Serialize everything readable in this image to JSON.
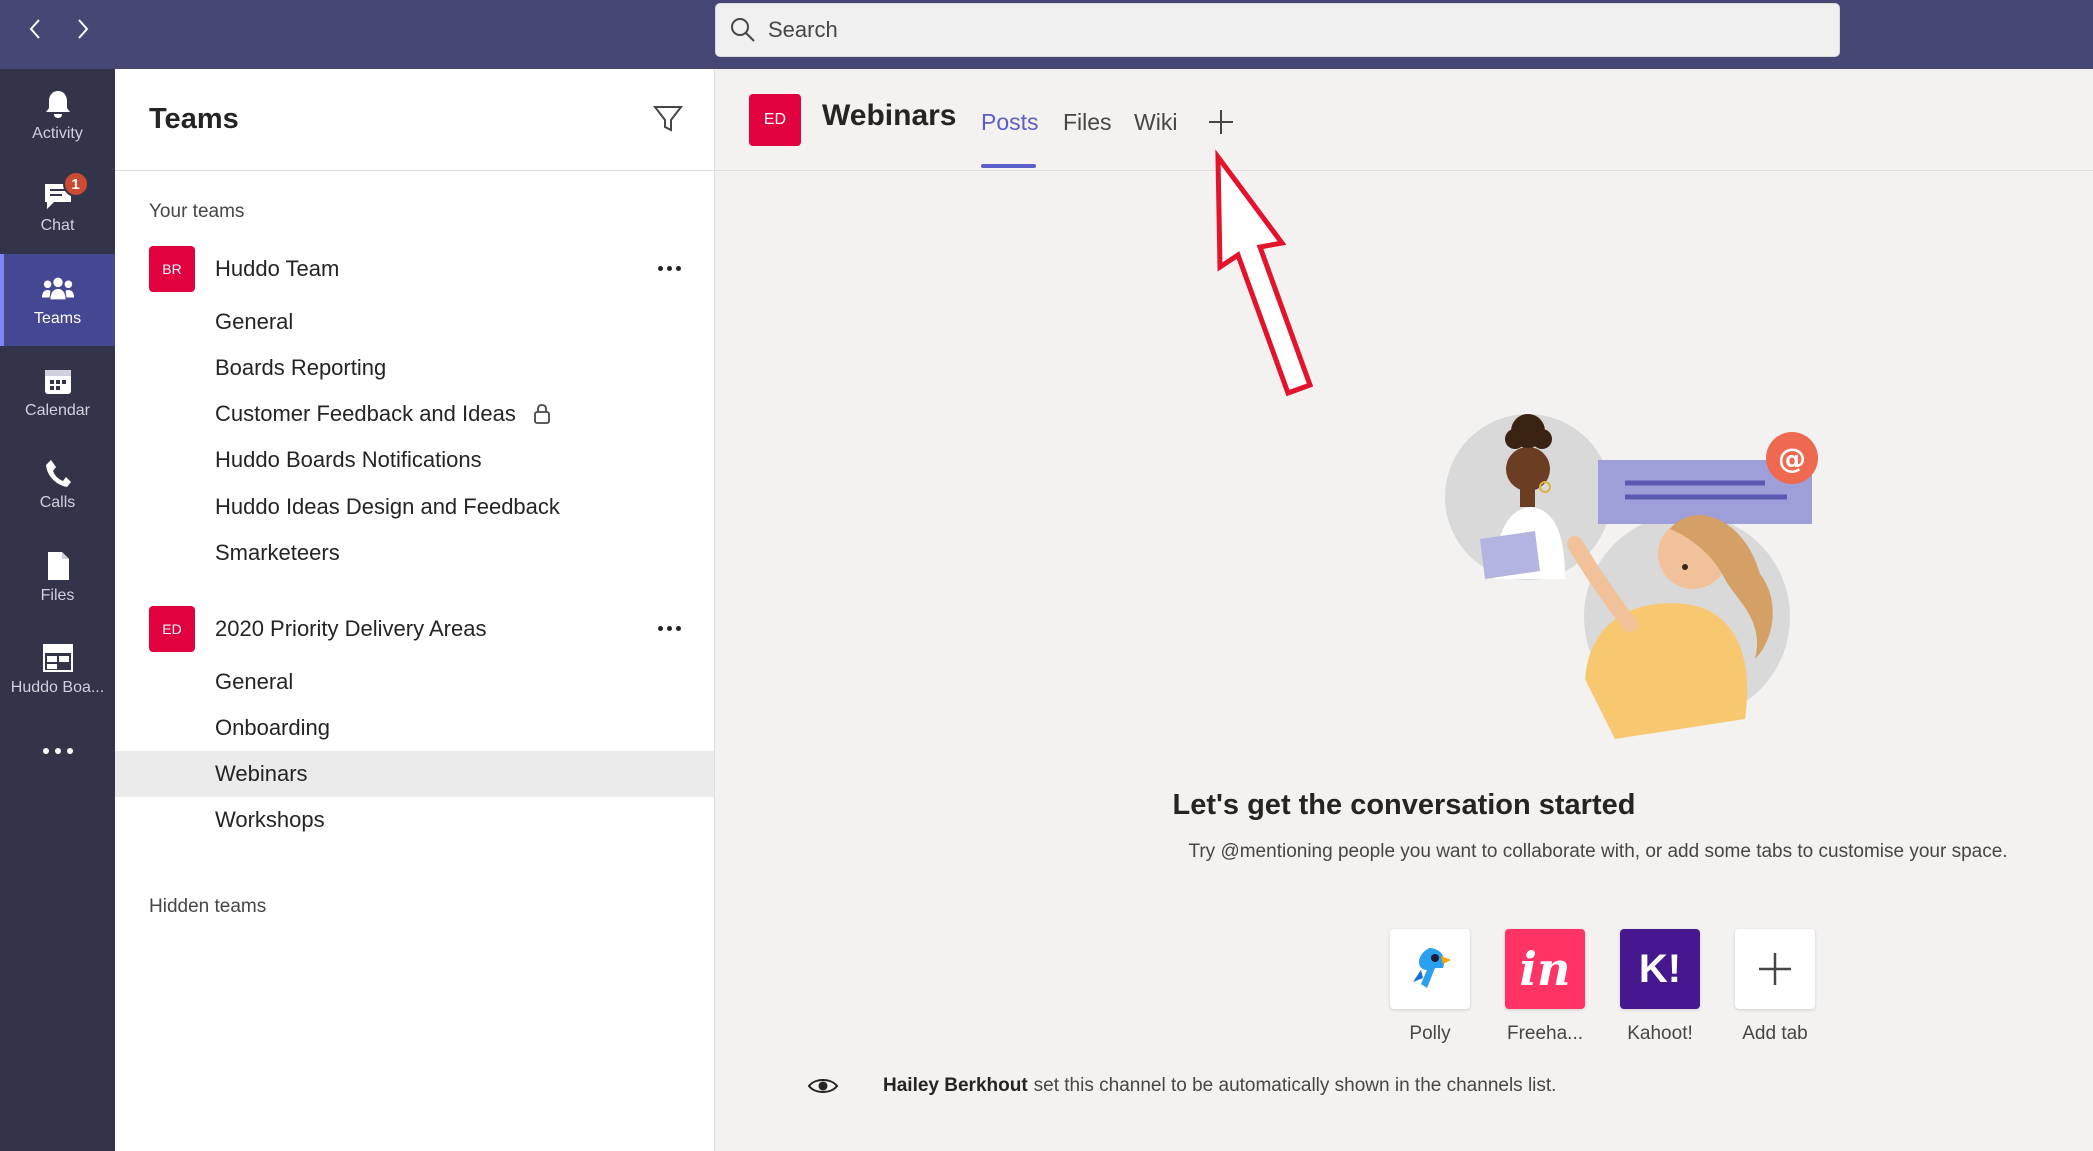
{
  "search": {
    "placeholder": "Search"
  },
  "rail": {
    "items": [
      {
        "label": "Activity",
        "icon": "bell-icon"
      },
      {
        "label": "Chat",
        "icon": "chat-icon",
        "badge": "1"
      },
      {
        "label": "Teams",
        "icon": "teams-icon",
        "active": true
      },
      {
        "label": "Calendar",
        "icon": "calendar-icon"
      },
      {
        "label": "Calls",
        "icon": "phone-icon"
      },
      {
        "label": "Files",
        "icon": "file-icon"
      },
      {
        "label": "Huddo Boa...",
        "icon": "boards-app-icon"
      }
    ],
    "more": "more-apps-icon"
  },
  "panel": {
    "title": "Teams",
    "your_teams_label": "Your teams",
    "hidden_teams_label": "Hidden teams",
    "teams": [
      {
        "avatar": "BR",
        "name": "Huddo Team",
        "channels": [
          "General",
          "Boards Reporting",
          "Customer Feedback and Ideas",
          "Huddo Boards Notifications",
          "Huddo Ideas Design and Feedback",
          "Smarketeers"
        ]
      },
      {
        "avatar": "ED",
        "name": "2020 Priority Delivery Areas",
        "channels": [
          "General",
          "Onboarding",
          "Webinars",
          "Workshops"
        ]
      }
    ],
    "selected_channel": "Webinars"
  },
  "channel": {
    "avatar": "ED",
    "title": "Webinars",
    "tabs": [
      "Posts",
      "Files",
      "Wiki"
    ],
    "active_tab": "Posts"
  },
  "empty_state": {
    "title": "Let's get the conversation started",
    "subtitle": "Try @mentioning people you want to collaborate with, or add some tabs to customise your space.",
    "apps": [
      {
        "label": "Polly",
        "color": "#ffffff"
      },
      {
        "label": "Freeha...",
        "color": "#ff3366",
        "glyph": "in"
      },
      {
        "label": "Kahoot!",
        "color": "#46178f",
        "glyph": "K!"
      },
      {
        "label": "Add tab",
        "color": "#ffffff"
      }
    ]
  },
  "notice": {
    "user": "Hailey Berkhout",
    "text": "set this channel to be automatically shown in the channels list."
  },
  "colors": {
    "titlebar": "#464775",
    "rail": "#33344a",
    "accent": "#5b5fc7",
    "team_avatar": "#e3003f",
    "badge": "#cc4a31",
    "annotation_arrow": "#e3132c"
  }
}
